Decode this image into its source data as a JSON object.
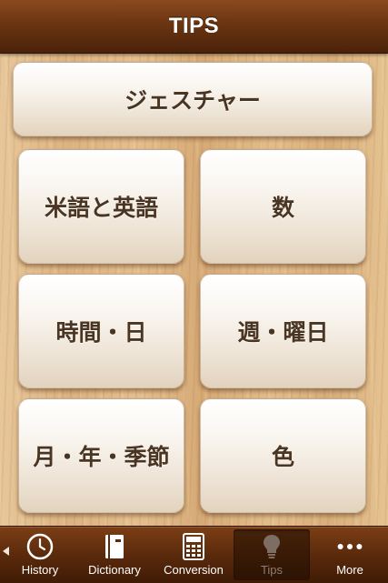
{
  "header": {
    "title": "TIPS"
  },
  "tiles": [
    {
      "label": "ジェスチャー"
    },
    {
      "label": "米語と英語"
    },
    {
      "label": "数"
    },
    {
      "label": "時間・日"
    },
    {
      "label": "週・曜日"
    },
    {
      "label": "月・年・季節"
    },
    {
      "label": "色"
    }
  ],
  "tabbar": {
    "items": [
      {
        "label": "History",
        "icon": "clock-icon"
      },
      {
        "label": "Dictionary",
        "icon": "book-icon"
      },
      {
        "label": "Conversion",
        "icon": "calculator-icon"
      },
      {
        "label": "Tips",
        "icon": "lightbulb-icon",
        "selected": true
      },
      {
        "label": "More",
        "icon": "more-dots-icon"
      }
    ]
  },
  "colors": {
    "header_brown": "#6b3512",
    "tab_bar_brown": "#5b2a0c",
    "tile_text": "#4a3422",
    "wood": "#dcb382"
  }
}
